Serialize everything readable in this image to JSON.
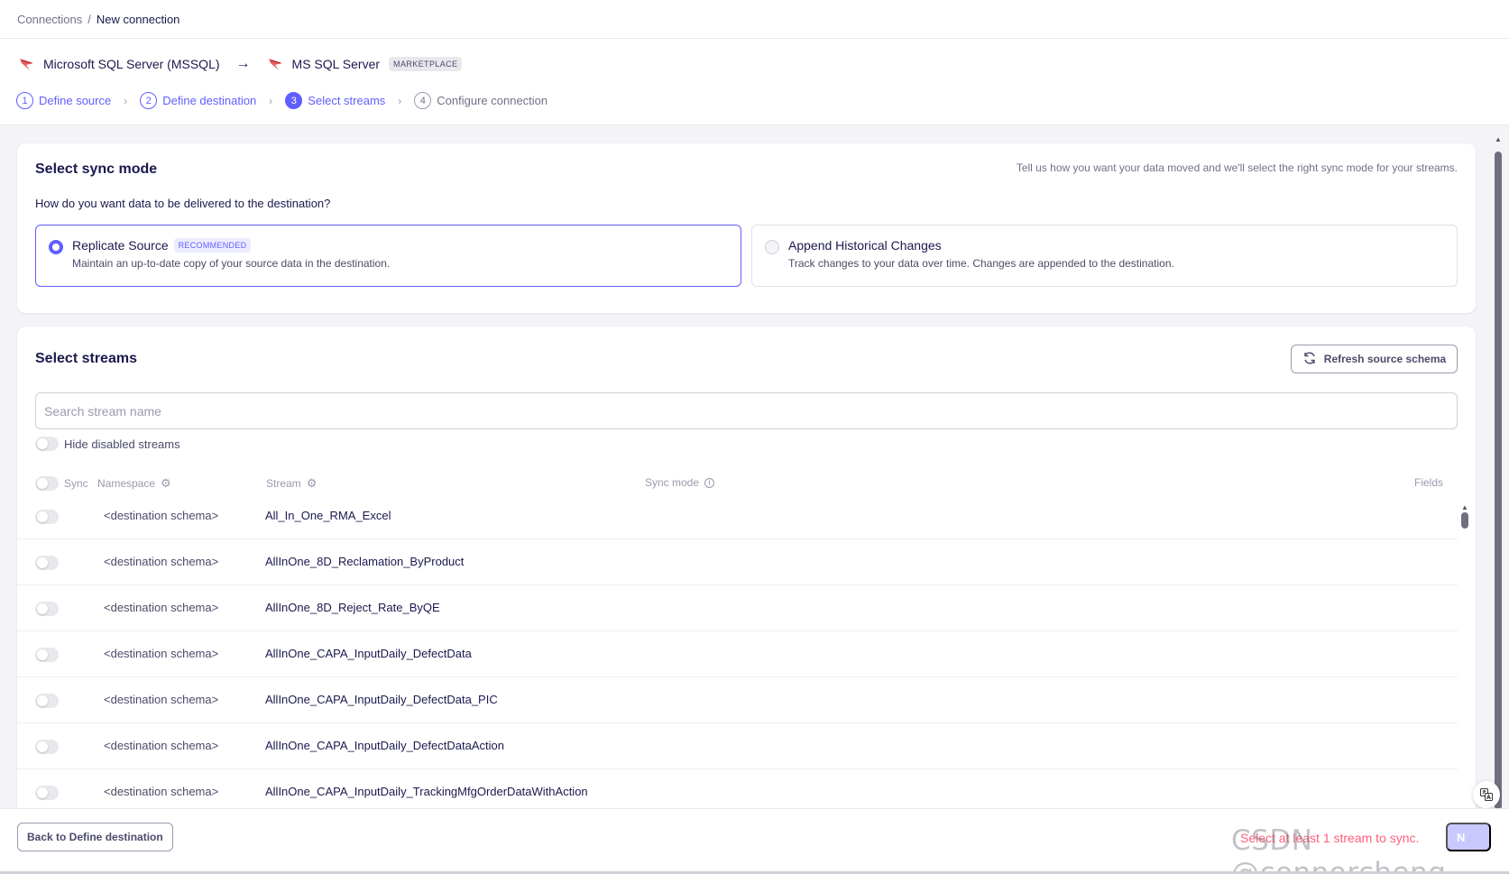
{
  "breadcrumb": {
    "parent": "Connections",
    "separator": "/",
    "current": "New connection"
  },
  "connection": {
    "source_name": "Microsoft SQL Server (MSSQL)",
    "arrow": "→",
    "destination_name": "MS SQL Server",
    "destination_badge": "MARKETPLACE"
  },
  "steps": [
    {
      "num": "1",
      "label": "Define source"
    },
    {
      "num": "2",
      "label": "Define destination"
    },
    {
      "num": "3",
      "label": "Select streams"
    },
    {
      "num": "4",
      "label": "Configure connection"
    }
  ],
  "sync_mode_card": {
    "title": "Select sync mode",
    "hint": "Tell us how you want your data moved and we'll select the right sync mode for your streams.",
    "question": "How do you want data to be delivered to the destination?",
    "options": [
      {
        "title": "Replicate Source",
        "badge": "RECOMMENDED",
        "desc": "Maintain an up-to-date copy of your source data in the destination.",
        "selected": true
      },
      {
        "title": "Append Historical Changes",
        "desc": "Track changes to your data over time. Changes are appended to the destination.",
        "selected": false
      }
    ]
  },
  "streams_card": {
    "title": "Select streams",
    "refresh_label": "Refresh source schema",
    "search_placeholder": "Search stream name",
    "hide_disabled_label": "Hide disabled streams",
    "columns": {
      "sync": "Sync",
      "namespace": "Namespace",
      "stream": "Stream",
      "sync_mode": "Sync mode",
      "fields": "Fields"
    },
    "rows": [
      {
        "namespace": "<destination schema>",
        "stream": "All_In_One_RMA_Excel"
      },
      {
        "namespace": "<destination schema>",
        "stream": "AllInOne_8D_Reclamation_ByProduct"
      },
      {
        "namespace": "<destination schema>",
        "stream": "AllInOne_8D_Reject_Rate_ByQE"
      },
      {
        "namespace": "<destination schema>",
        "stream": "AllInOne_CAPA_InputDaily_DefectData"
      },
      {
        "namespace": "<destination schema>",
        "stream": "AllInOne_CAPA_InputDaily_DefectData_PIC"
      },
      {
        "namespace": "<destination schema>",
        "stream": "AllInOne_CAPA_InputDaily_DefectDataAction"
      },
      {
        "namespace": "<destination schema>",
        "stream": "AllInOne_CAPA_InputDaily_TrackingMfgOrderDataWithAction"
      }
    ]
  },
  "footer": {
    "back_label": "Back to Define destination",
    "error_text": "Select at least 1 stream to sync.",
    "next_label": "N"
  },
  "watermark": "CSDN @connorcheng",
  "colors": {
    "accent": "#615eff",
    "error": "#ff5e7b",
    "text": "#1a194d",
    "muted": "#717189"
  }
}
